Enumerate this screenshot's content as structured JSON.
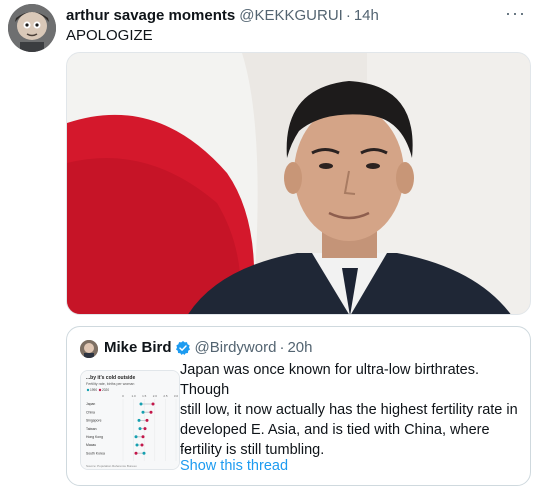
{
  "tweet": {
    "display_name": "arthur savage moments",
    "handle": "@KEKKGURUI",
    "separator": "·",
    "time": "14h",
    "more_label": "···",
    "text": "APOLOGIZE"
  },
  "quoted_tweet": {
    "display_name": "Mike Bird",
    "handle": "@Birdyword",
    "separator": "·",
    "time": "20h",
    "body_lines": [
      "Japan was once known for ultra-low birthrates. Though",
      "still low, it now actually has the highest fertility rate in",
      "developed E. Asia, and is tied with China, where",
      "fertility is still tumbling."
    ],
    "ellipsis": "...",
    "show_thread_label": "Show this thread"
  },
  "thumbnail_chart": {
    "title": "...by it's cold outside",
    "subtitle": "Fertility rate, births per woman",
    "legend": [
      "1990",
      "2020"
    ],
    "ticks": [
      "0",
      "1.0",
      "1.5",
      "2.0",
      "2.5",
      "3.0"
    ],
    "rows": [
      "Japan",
      "China",
      "Singapore",
      "Taiwan",
      "Hong Kong",
      "Macau",
      "South Korea"
    ],
    "footer": "Source: Population Reference Bureau"
  },
  "colors": {
    "link": "#1d9bf0",
    "verified": "#1d9bf0",
    "flag_red": "#c8182b",
    "secondary_text": "#536471"
  }
}
